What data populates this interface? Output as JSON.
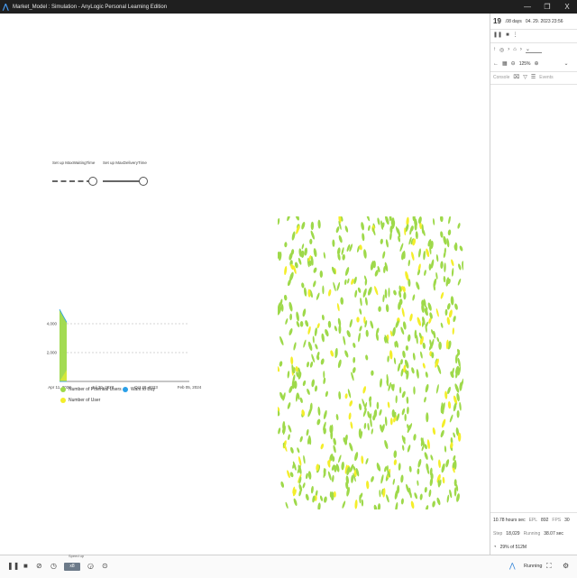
{
  "window": {
    "title": "Market_Model : Simulation - AnyLogic Personal Learning Edition",
    "minimize": "—",
    "restore": "❐",
    "close": "X"
  },
  "sliders": [
    {
      "label": "Set up MaxWaitingTime",
      "value_fraction": 1.0,
      "style": "dashed"
    },
    {
      "label": "Set up MaxDeliveryTime",
      "value_fraction": 1.0,
      "style": "solid"
    }
  ],
  "chart_data": {
    "type": "area",
    "title": "",
    "xlabel": "",
    "ylabel": "",
    "x_ticks": [
      "Apr 11, 2023",
      "Jul 30, 2023",
      "Oct 28, 2023",
      "Feb 05, 2024"
    ],
    "y_ticks": [
      "2,000",
      "4,000"
    ],
    "ylim": [
      0,
      5000
    ],
    "grid": true,
    "legend_placement": "bottom",
    "series": [
      {
        "name": "Number of Potential Users",
        "color": "#9ed94a",
        "x": [
          "Apr 11, 2023",
          "Apr 30, 2023"
        ],
        "y": [
          5000,
          4100
        ]
      },
      {
        "name": "Want to Buy",
        "color": "#2aa0e8",
        "x": [
          "Apr 11, 2023",
          "Apr 30, 2023"
        ],
        "y": [
          0,
          0
        ]
      },
      {
        "name": "Number of User",
        "color": "#f4ee2a",
        "x": [
          "Apr 11, 2023",
          "Apr 30, 2023"
        ],
        "y": [
          0,
          800
        ]
      }
    ]
  },
  "agents_colors": {
    "potential": "#9ed94a",
    "user": "#f4ee2a"
  },
  "right_panel": {
    "day": "19",
    "days_label": ".08 days",
    "datetime": "04. 29. 2023 23:56",
    "zoom": "125%",
    "tabs": [
      "Console",
      "Events"
    ],
    "stats": {
      "hours_per_sec": "10.78 hours sec",
      "fps_label": "FPS",
      "fps_value": "30",
      "eps_label": "EPL",
      "eps_value": "892",
      "step_label": "Step",
      "step_value": "18,029",
      "running_label": "Running",
      "running_value": "38.07 sec",
      "memory": "29% of 512M"
    }
  },
  "bottombar": {
    "speed_label": "Speed up",
    "speed_value": "x8",
    "status": "Running"
  }
}
